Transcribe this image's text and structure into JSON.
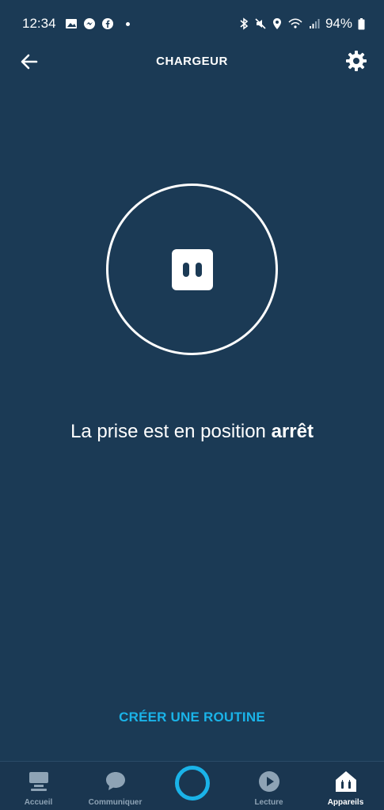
{
  "status_bar": {
    "time": "12:34",
    "battery": "94%",
    "icons_left": [
      "gallery-icon",
      "messenger-icon",
      "facebook-icon"
    ],
    "icons_right": [
      "bluetooth-icon",
      "mute-icon",
      "location-icon",
      "wifi-icon",
      "signal-icon",
      "battery-icon"
    ]
  },
  "app_bar": {
    "title": "CHARGEUR"
  },
  "device": {
    "status_prefix": "La prise est en position ",
    "status_value": "arrêt"
  },
  "routine_link": "CRÉER UNE ROUTINE",
  "bottom_nav": {
    "items": [
      {
        "label": "Accueil",
        "icon": "home-icon",
        "active": false
      },
      {
        "label": "Communiquer",
        "icon": "chat-bubble-icon",
        "active": false
      },
      {
        "label": "Lecture",
        "icon": "play-icon",
        "active": false
      },
      {
        "label": "Appareils",
        "icon": "devices-icon",
        "active": true
      }
    ]
  },
  "colors": {
    "background": "#1b3a55",
    "accent": "#1ab3e8",
    "nav_inactive": "#8ea3b5"
  }
}
